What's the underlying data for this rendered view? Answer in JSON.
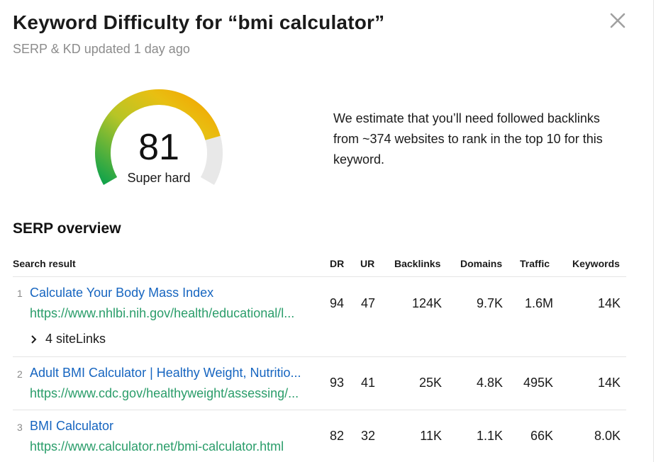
{
  "header": {
    "title": "Keyword Difficulty for “bmi calculator”",
    "subtitle": "SERP & KD updated 1 day ago"
  },
  "kd": {
    "score": "81",
    "label": "Super hard",
    "fraction": 0.81,
    "estimate": "We estimate that you’ll need followed backlinks from ~374 websites to rank in the top 10 for this keyword."
  },
  "serp": {
    "title": "SERP overview",
    "columns": {
      "result": "Search result",
      "dr": "DR",
      "ur": "UR",
      "backlinks": "Backlinks",
      "domains": "Domains",
      "traffic": "Traffic",
      "keywords": "Keywords"
    },
    "rows": [
      {
        "rank": "1",
        "title": "Calculate Your Body Mass Index",
        "url": "https://www.nhlbi.nih.gov/health/educational/l...",
        "dr": "94",
        "ur": "47",
        "backlinks": "124K",
        "domains": "9.7K",
        "traffic": "1.6M",
        "keywords": "14K",
        "sitelinks": "4 siteLinks"
      },
      {
        "rank": "2",
        "title": "Adult BMI Calculator | Healthy Weight, Nutritio...",
        "url": "https://www.cdc.gov/healthyweight/assessing/...",
        "dr": "93",
        "ur": "41",
        "backlinks": "25K",
        "domains": "4.8K",
        "traffic": "495K",
        "keywords": "14K"
      },
      {
        "rank": "3",
        "title": "BMI Calculator",
        "url": "https://www.calculator.net/bmi-calculator.html",
        "dr": "82",
        "ur": "32",
        "backlinks": "11K",
        "domains": "1.1K",
        "traffic": "66K",
        "keywords": "8.0K"
      }
    ]
  },
  "colors": {
    "link": "#1665c0",
    "url": "#2a9d6a",
    "gauge_track": "#e8e8e8",
    "gauge_start": "#13a34a",
    "gauge_mid": "#d6c51a",
    "gauge_end": "#f4a300"
  },
  "icons": {
    "close": "close-icon",
    "expand": "chevron-right-icon"
  }
}
